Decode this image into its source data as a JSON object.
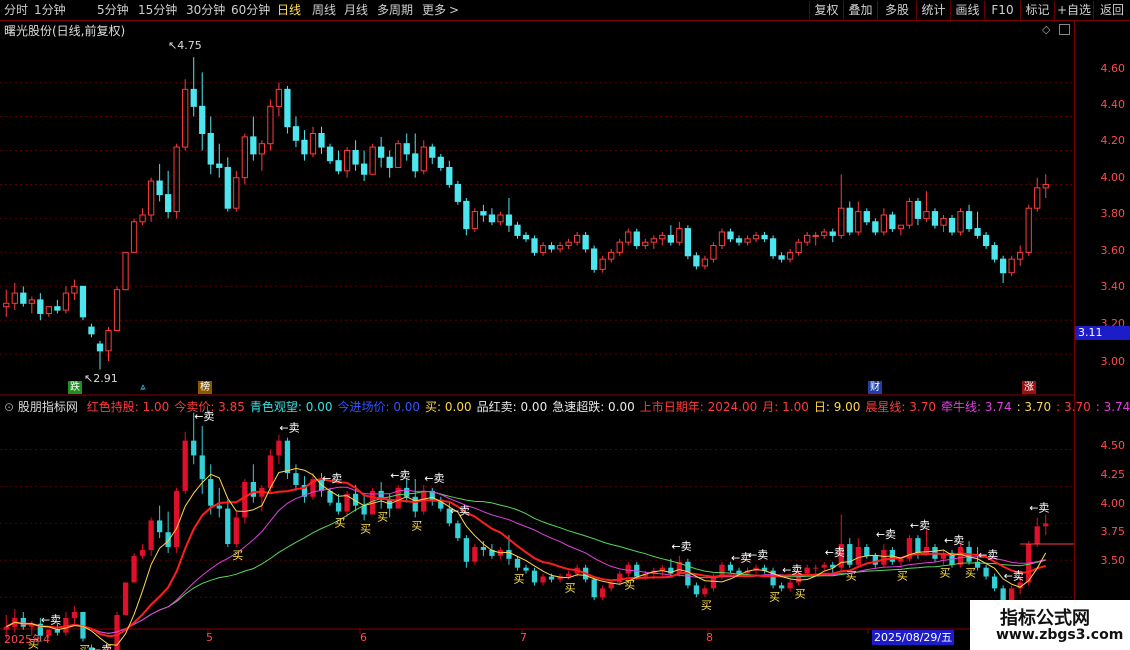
{
  "toolbar": {
    "timeframes": [
      "分时",
      "1分钟",
      "5分钟",
      "15分钟",
      "30分钟",
      "60分钟",
      "日线",
      "周线",
      "月线",
      "多周期",
      "更多"
    ],
    "active": "日线",
    "more_arrow": ">",
    "right_buttons": [
      "复权",
      "叠加",
      "多股",
      "统计",
      "画线",
      "F10",
      "标记",
      "+自选",
      "返回"
    ]
  },
  "main_panel": {
    "title": "曙光股份(日线,前复权)",
    "price_axis": [
      "4.60",
      "4.40",
      "4.20",
      "4.00",
      "3.80",
      "3.60",
      "3.40",
      "3.20",
      "3.00"
    ],
    "current_price": "3.11",
    "high_label": "4.75",
    "low_label": "2.91",
    "event_tags": [
      {
        "text": "跌",
        "color": "#1f8f1f"
      },
      {
        "text": "榜",
        "color": "#8a5a00"
      },
      {
        "text": "财",
        "color": "#1f3fa8"
      },
      {
        "text": "涨",
        "color": "#9a1010"
      }
    ]
  },
  "indicator_panel": {
    "title": "股朋指标网",
    "items": [
      {
        "text": "红色持股: 1.00",
        "color": "#ff3b3b"
      },
      {
        "text": "今卖价: 3.85",
        "color": "#ff3b3b"
      },
      {
        "text": "青色观望: 0.00",
        "color": "#38e0e0"
      },
      {
        "text": "今进场价: 0.00",
        "color": "#3355ff"
      },
      {
        "text": "买: 0.00",
        "color": "#ffd84a"
      },
      {
        "text": "品红卖: 0.00",
        "color": "#e8e8e8"
      },
      {
        "text": "急速超跌: 0.00",
        "color": "#e8e8e8"
      },
      {
        "text": "上市日期年: 2024.00",
        "color": "#ff3b3b"
      },
      {
        "text": "月: 1.00",
        "color": "#ff3b3b"
      },
      {
        "text": "日: 9.00",
        "color": "#ffd84a"
      },
      {
        "text": "晨星线: 3.70",
        "color": "#ff3b3b"
      },
      {
        "text": "牵牛线: 3.74",
        "color": "#e040e0"
      },
      {
        "text": ": 3.70",
        "color": "#ffd84a"
      },
      {
        "text": ": 3.70",
        "color": "#ff3b3b"
      },
      {
        "text": ": 3.74",
        "color": "#e040e0"
      }
    ],
    "axis": [
      "4.50",
      "4.25",
      "4.00",
      "3.75",
      "3.50"
    ],
    "buy_label": "买",
    "sell_label": "←卖",
    "buy_arrow_label": "←买"
  },
  "x_axis": {
    "labels": [
      "2025年4",
      "5",
      "6",
      "7",
      "8"
    ],
    "cursor_date": "2025/08/29/五"
  },
  "watermark": {
    "line1": "指标公式网",
    "line2": "www.zbgs3.com"
  },
  "chart_data": {
    "type": "candlestick",
    "ohlc": [
      [
        3.28,
        3.38,
        3.22,
        3.3
      ],
      [
        3.3,
        3.42,
        3.26,
        3.36
      ],
      [
        3.36,
        3.4,
        3.28,
        3.3
      ],
      [
        3.3,
        3.34,
        3.24,
        3.32
      ],
      [
        3.32,
        3.36,
        3.2,
        3.24
      ],
      [
        3.24,
        3.28,
        3.22,
        3.28
      ],
      [
        3.28,
        3.32,
        3.24,
        3.26
      ],
      [
        3.26,
        3.4,
        3.24,
        3.36
      ],
      [
        3.36,
        3.44,
        3.32,
        3.4
      ],
      [
        3.4,
        3.4,
        3.2,
        3.22
      ],
      [
        3.16,
        3.18,
        3.1,
        3.12
      ],
      [
        3.06,
        3.08,
        2.91,
        3.02
      ],
      [
        3.02,
        3.16,
        2.96,
        3.14
      ],
      [
        3.14,
        3.4,
        3.14,
        3.38
      ],
      [
        3.38,
        3.6,
        3.38,
        3.6
      ],
      [
        3.6,
        3.8,
        3.6,
        3.78
      ],
      [
        3.78,
        3.86,
        3.76,
        3.82
      ],
      [
        3.82,
        4.04,
        3.78,
        4.02
      ],
      [
        4.02,
        4.12,
        3.9,
        3.94
      ],
      [
        3.94,
        4.08,
        3.8,
        3.84
      ],
      [
        3.84,
        4.24,
        3.8,
        4.22
      ],
      [
        4.22,
        4.62,
        4.2,
        4.56
      ],
      [
        4.56,
        4.75,
        4.4,
        4.46
      ],
      [
        4.46,
        4.66,
        4.2,
        4.3
      ],
      [
        4.3,
        4.4,
        4.06,
        4.12
      ],
      [
        4.12,
        4.24,
        4.04,
        4.1
      ],
      [
        4.1,
        4.16,
        3.84,
        3.86
      ],
      [
        3.86,
        4.08,
        3.84,
        4.04
      ],
      [
        4.04,
        4.3,
        4.0,
        4.28
      ],
      [
        4.28,
        4.4,
        4.14,
        4.18
      ],
      [
        4.18,
        4.26,
        4.08,
        4.24
      ],
      [
        4.24,
        4.5,
        4.2,
        4.46
      ],
      [
        4.46,
        4.6,
        4.4,
        4.56
      ],
      [
        4.56,
        4.58,
        4.3,
        4.34
      ],
      [
        4.34,
        4.4,
        4.22,
        4.26
      ],
      [
        4.26,
        4.32,
        4.14,
        4.18
      ],
      [
        4.18,
        4.34,
        4.16,
        4.3
      ],
      [
        4.3,
        4.34,
        4.18,
        4.22
      ],
      [
        4.22,
        4.24,
        4.12,
        4.14
      ],
      [
        4.14,
        4.2,
        4.06,
        4.08
      ],
      [
        4.08,
        4.22,
        4.04,
        4.2
      ],
      [
        4.2,
        4.26,
        4.08,
        4.12
      ],
      [
        4.12,
        4.2,
        4.02,
        4.06
      ],
      [
        4.06,
        4.24,
        4.06,
        4.22
      ],
      [
        4.22,
        4.28,
        4.1,
        4.16
      ],
      [
        4.16,
        4.2,
        4.04,
        4.1
      ],
      [
        4.1,
        4.26,
        4.1,
        4.24
      ],
      [
        4.24,
        4.3,
        4.14,
        4.18
      ],
      [
        4.18,
        4.3,
        4.04,
        4.08
      ],
      [
        4.08,
        4.26,
        4.06,
        4.22
      ],
      [
        4.22,
        4.24,
        4.12,
        4.16
      ],
      [
        4.16,
        4.18,
        4.08,
        4.1
      ],
      [
        4.1,
        4.14,
        3.98,
        4.0
      ],
      [
        4.0,
        4.02,
        3.88,
        3.9
      ],
      [
        3.9,
        3.92,
        3.7,
        3.74
      ],
      [
        3.74,
        3.86,
        3.72,
        3.84
      ],
      [
        3.84,
        3.88,
        3.78,
        3.82
      ],
      [
        3.82,
        3.86,
        3.76,
        3.78
      ],
      [
        3.78,
        3.84,
        3.76,
        3.82
      ],
      [
        3.82,
        3.92,
        3.72,
        3.76
      ],
      [
        3.76,
        3.78,
        3.68,
        3.7
      ],
      [
        3.7,
        3.72,
        3.66,
        3.68
      ],
      [
        3.68,
        3.7,
        3.58,
        3.6
      ],
      [
        3.6,
        3.66,
        3.58,
        3.64
      ],
      [
        3.64,
        3.66,
        3.6,
        3.62
      ],
      [
        3.62,
        3.66,
        3.6,
        3.64
      ],
      [
        3.64,
        3.68,
        3.62,
        3.66
      ],
      [
        3.66,
        3.72,
        3.64,
        3.7
      ],
      [
        3.7,
        3.72,
        3.6,
        3.62
      ],
      [
        3.62,
        3.64,
        3.48,
        3.5
      ],
      [
        3.5,
        3.58,
        3.48,
        3.56
      ],
      [
        3.56,
        3.62,
        3.54,
        3.6
      ],
      [
        3.6,
        3.68,
        3.58,
        3.66
      ],
      [
        3.66,
        3.74,
        3.64,
        3.72
      ],
      [
        3.72,
        3.74,
        3.62,
        3.64
      ],
      [
        3.64,
        3.68,
        3.62,
        3.66
      ],
      [
        3.66,
        3.7,
        3.62,
        3.68
      ],
      [
        3.68,
        3.72,
        3.64,
        3.7
      ],
      [
        3.7,
        3.76,
        3.64,
        3.66
      ],
      [
        3.66,
        3.78,
        3.64,
        3.74
      ],
      [
        3.74,
        3.76,
        3.56,
        3.58
      ],
      [
        3.58,
        3.6,
        3.5,
        3.52
      ],
      [
        3.52,
        3.58,
        3.5,
        3.56
      ],
      [
        3.56,
        3.66,
        3.54,
        3.64
      ],
      [
        3.64,
        3.74,
        3.62,
        3.72
      ],
      [
        3.72,
        3.74,
        3.66,
        3.68
      ],
      [
        3.68,
        3.7,
        3.64,
        3.66
      ],
      [
        3.66,
        3.7,
        3.64,
        3.68
      ],
      [
        3.68,
        3.72,
        3.66,
        3.7
      ],
      [
        3.7,
        3.72,
        3.66,
        3.68
      ],
      [
        3.68,
        3.7,
        3.56,
        3.58
      ],
      [
        3.58,
        3.6,
        3.54,
        3.56
      ],
      [
        3.56,
        3.62,
        3.54,
        3.6
      ],
      [
        3.6,
        3.68,
        3.58,
        3.66
      ],
      [
        3.66,
        3.72,
        3.64,
        3.7
      ],
      [
        3.7,
        3.72,
        3.64,
        3.7
      ],
      [
        3.7,
        3.74,
        3.68,
        3.72
      ],
      [
        3.72,
        3.74,
        3.66,
        3.7
      ],
      [
        3.7,
        4.06,
        3.68,
        3.86
      ],
      [
        3.86,
        3.9,
        3.7,
        3.72
      ],
      [
        3.72,
        3.9,
        3.7,
        3.84
      ],
      [
        3.84,
        3.86,
        3.76,
        3.78
      ],
      [
        3.78,
        3.8,
        3.7,
        3.72
      ],
      [
        3.72,
        3.86,
        3.7,
        3.82
      ],
      [
        3.82,
        3.84,
        3.72,
        3.74
      ],
      [
        3.74,
        3.76,
        3.7,
        3.76
      ],
      [
        3.76,
        3.92,
        3.74,
        3.9
      ],
      [
        3.9,
        3.92,
        3.76,
        3.8
      ],
      [
        3.8,
        3.96,
        3.78,
        3.84
      ],
      [
        3.84,
        3.86,
        3.74,
        3.76
      ],
      [
        3.76,
        3.82,
        3.72,
        3.8
      ],
      [
        3.8,
        3.82,
        3.7,
        3.72
      ],
      [
        3.72,
        3.86,
        3.7,
        3.84
      ],
      [
        3.84,
        3.88,
        3.72,
        3.74
      ],
      [
        3.74,
        3.84,
        3.68,
        3.7
      ],
      [
        3.7,
        3.72,
        3.62,
        3.64
      ],
      [
        3.64,
        3.66,
        3.54,
        3.56
      ],
      [
        3.56,
        3.58,
        3.42,
        3.48
      ],
      [
        3.48,
        3.58,
        3.46,
        3.56
      ],
      [
        3.56,
        3.64,
        3.52,
        3.6
      ],
      [
        3.6,
        3.88,
        3.58,
        3.86
      ],
      [
        3.86,
        4.04,
        3.84,
        3.98
      ],
      [
        3.98,
        4.06,
        3.92,
        4.0
      ]
    ],
    "ylim": [
      2.86,
      4.78
    ]
  }
}
